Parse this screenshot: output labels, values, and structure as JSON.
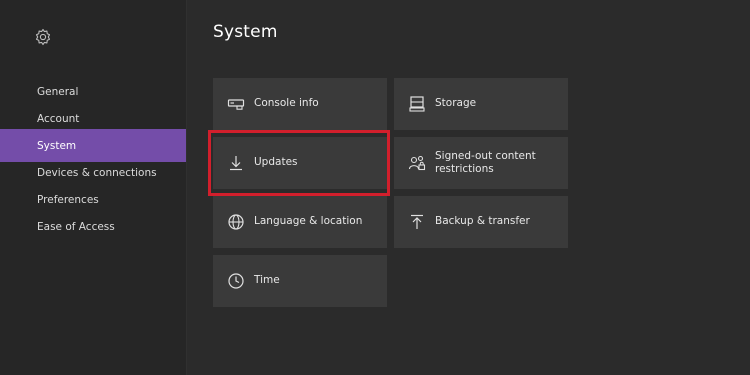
{
  "page": {
    "title": "System"
  },
  "sidebar": {
    "items": [
      {
        "label": "General"
      },
      {
        "label": "Account"
      },
      {
        "label": "System",
        "selected": true
      },
      {
        "label": "Devices & connections"
      },
      {
        "label": "Preferences"
      },
      {
        "label": "Ease of Access"
      }
    ]
  },
  "tiles": {
    "console_info": "Console info",
    "storage": "Storage",
    "updates": "Updates",
    "signed_out_1": "Signed-out content",
    "signed_out_2": "restrictions",
    "language": "Language & location",
    "backup": "Backup & transfer",
    "time": "Time"
  },
  "colors": {
    "accent": "#744da9",
    "highlight": "#d21f2c",
    "tile": "#3a3a3a",
    "background": "#2b2b2b"
  },
  "icons": [
    "gear-icon",
    "console-icon",
    "storage-icon",
    "download-icon",
    "people-lock-icon",
    "globe-icon",
    "upload-icon",
    "clock-icon"
  ]
}
